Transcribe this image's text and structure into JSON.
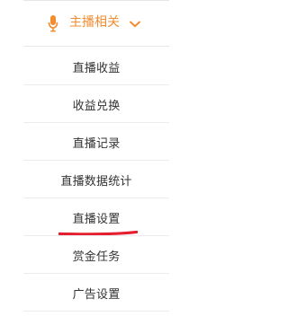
{
  "menu": {
    "header": {
      "icon": "microphone-icon",
      "label": "主播相关",
      "chevron_icon": "chevron-down-icon",
      "accent_color": "#f28c2f"
    },
    "items": [
      {
        "label": "直播收益"
      },
      {
        "label": "收益兑换"
      },
      {
        "label": "直播记录"
      },
      {
        "label": "直播数据统计"
      },
      {
        "label": "直播设置"
      },
      {
        "label": "赏金任务"
      },
      {
        "label": "广告设置"
      }
    ],
    "highlight_mark_color": "#e41f2f"
  }
}
